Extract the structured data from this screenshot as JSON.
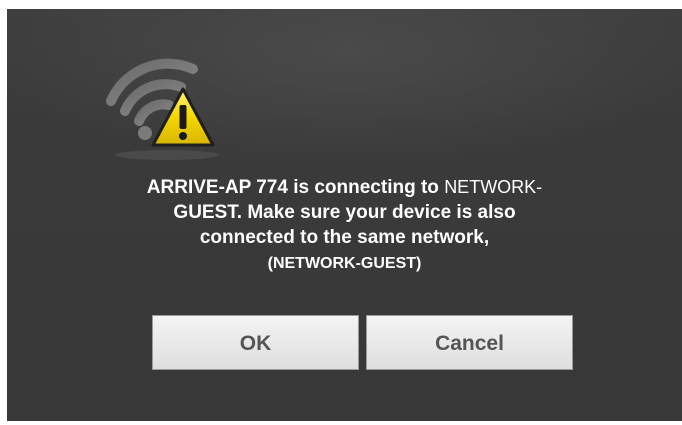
{
  "dialog": {
    "icon": "wifi-warning-icon",
    "message": {
      "part1": "ARRIVE-AP 774 is connecting to ",
      "network_inline": "NETWORK-",
      "part2": "GUEST. Make sure your device is also",
      "part3": "connected to the same network,",
      "network_paren": "(NETWORK-GUEST)"
    },
    "buttons": {
      "ok_label": "OK",
      "cancel_label": "Cancel"
    }
  },
  "colors": {
    "background": "#3a3a3a",
    "text": "#ffffff",
    "warning_yellow": "#f5d800",
    "button_face": "#e8e8e8"
  }
}
